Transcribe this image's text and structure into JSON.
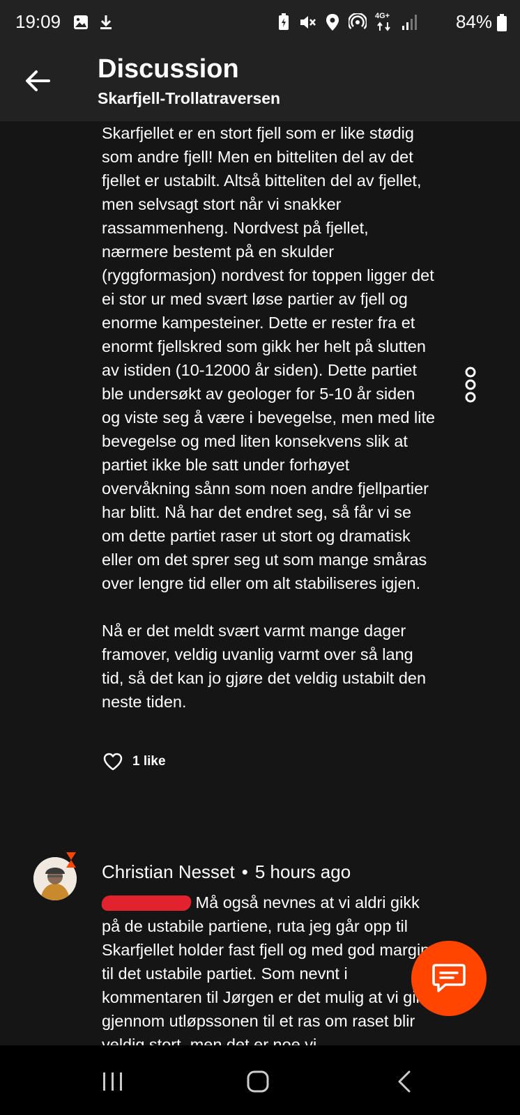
{
  "status_bar": {
    "time": "19:09",
    "battery": "84%",
    "left_icons": [
      "image-icon",
      "download-icon"
    ],
    "right_icons": [
      "battery-saver-icon",
      "mute-icon",
      "location-icon",
      "hotspot-icon",
      "network-4g-icon",
      "signal-icon",
      "battery-icon"
    ],
    "network_label": "4G+"
  },
  "header": {
    "title": "Discussion",
    "subtitle": "Skarfjell-Trollatraversen"
  },
  "comment1": {
    "paragraph1": "Skarfjellet er en stort fjell som er like stødig som andre fjell! Men en bitteliten del av det fjellet er ustabilt. Altså bitteliten del av fjellet, men selvsagt stort når vi snakker rassammenheng. Nordvest på fjellet, nærmere bestemt på en skulder (ryggformasjon) nordvest for toppen ligger det ei stor ur med svært løse partier av fjell og enorme kampesteiner. Dette er rester fra et enormt fjellskred som gikk her helt på slutten av istiden (10-12000 år siden). Dette partiet ble undersøkt av geologer for 5-10 år siden og viste seg å være i bevegelse, men med lite bevegelse og med liten konsekvens slik at partiet ikke ble satt under forhøyet overvåkning sånn som noen andre fjellpartier har blitt. Nå har det endret seg, så får vi se om dette partiet raser ut stort og dramatisk eller om det sprer seg ut som mange småras over lengre tid eller om alt stabiliseres igjen.",
    "paragraph2": "Nå er det meldt svært varmt mange dager framover, veldig uvanlig varmt over så lang tid, så det kan jo gjøre det veldig ustabilt den neste tiden.",
    "likes": "1 like"
  },
  "comment2": {
    "author": "Christian Nesset",
    "separator": "•",
    "time_ago": "5 hours ago",
    "text": " Må også nevnes at vi aldri gikk på de ustabile partiene, ruta jeg går opp til Skarfjellet holder fast fjell og med god margin til det ustabile partiet. Som nevnt i kommentaren til Jørgen er det mulig at vi gikk gjennom utløpssonen til et ras om raset blir veldig stort, men det er noe vi"
  },
  "colors": {
    "background": "#151515",
    "header": "#222222",
    "fab": "#ff4500",
    "redaction": "#e0232f",
    "nav_bar": "#000000"
  }
}
